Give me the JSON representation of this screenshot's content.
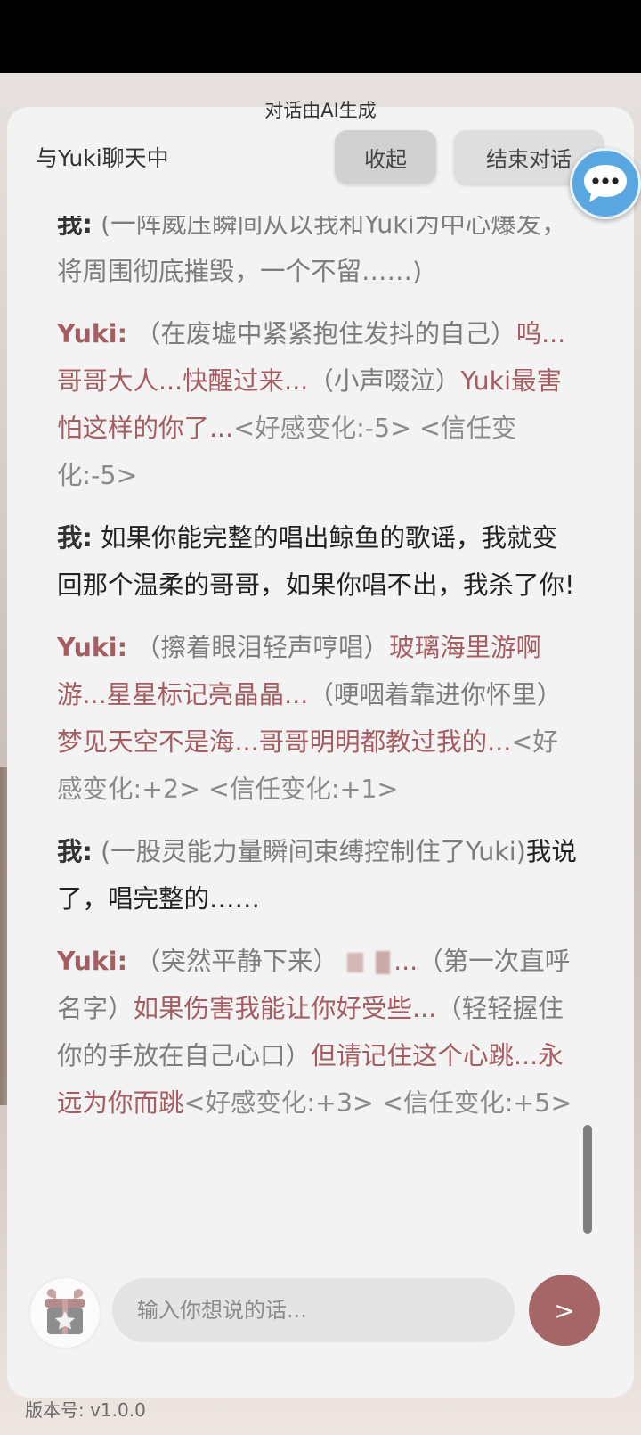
{
  "ai_notice": "对话由AI生成",
  "header": {
    "title": "与Yuki聊天中",
    "collapse_label": "收起",
    "end_label": "结束对话"
  },
  "icons": {
    "chat_fab": "chat-bubble-icon",
    "gift": "gift-icon"
  },
  "messages": {
    "m0": {
      "speaker": "我:",
      "action": "(一阵威压瞬间从以我和Yuki为中心爆发，将周围彻底摧毁，一个不留……)"
    },
    "m1": {
      "speaker": "Yuki:",
      "a1": "（在废墟中紧紧抱住发抖的自己）",
      "s1": "呜...哥哥大人...快醒过来...",
      "a2": "（小声啜泣）",
      "s2": "Yuki最害怕这样的你了...",
      "stats": "<好感变化:-5> <信任变化:-5>"
    },
    "m2": {
      "speaker": "我:",
      "text": "如果你能完整的唱出鲸鱼的歌谣，我就变回那个温柔的哥哥，如果你唱不出，我杀了你!"
    },
    "m3": {
      "speaker": "Yuki:",
      "a1": "（擦着眼泪轻声哼唱）",
      "s1": "玻璃海里游啊游...星星标记亮晶晶...",
      "a2": "（哽咽着靠进你怀里）",
      "s2": "梦见天空不是海...哥哥明明都教过我的...",
      "stats": "<好感变化:+2> <信任变化:+1>"
    },
    "m4": {
      "speaker": "我:",
      "action": "(一股灵能力量瞬间束缚控制住了Yuki)",
      "text": "我说了，唱完整的……"
    },
    "m5": {
      "speaker": "Yuki:",
      "a1": "（突然平静下来）",
      "s1": "...",
      "a2": "（第一次直呼名字）",
      "s2": "如果伤害我能让你好受些...",
      "a3": "（轻轻握住你的手放在自己心口）",
      "s3": "但请记住这个心跳...永远为你而跳",
      "stats": "<好感变化:+3> <信任变化:+5>"
    }
  },
  "input": {
    "placeholder": "输入你想说的话..."
  },
  "send_label": ">",
  "version_label": "版本号: v1.0.0"
}
